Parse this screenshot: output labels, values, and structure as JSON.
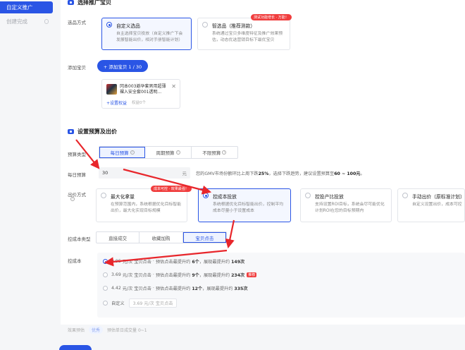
{
  "sidebar": {
    "items": [
      {
        "label": "自定义推广",
        "active": true
      },
      {
        "label": "创建完成",
        "active": false
      }
    ]
  },
  "section_promo": {
    "title": "选择推广宝贝",
    "method_label": "选品方式",
    "cards": [
      {
        "title": "自定义选品",
        "desc": "自主选择宝贝投放（自定义推广下会发展智能出价，相对手册智能计划）",
        "selected": true
      },
      {
        "title": "智选品（推荐测款）",
        "desc": "系统通过宝贝多维度特征及推广效果预估，动态优选营销目标下最优宝贝",
        "selected": false,
        "badge": "测试功能增长 · 万能！"
      }
    ],
    "add_label": "添加宝贝",
    "add_button": "+ 添加宝贝 1 / 30",
    "product": {
      "name": "冈本003避孕套男用超薄裸入安全套001透明...",
      "link": "+设置权益",
      "tip": "权益0个"
    }
  },
  "section_budget": {
    "title": "设置预算及出价",
    "budget_type_label": "预算类型",
    "budget_types": [
      "每日预算",
      "周期预算",
      "不限预算"
    ],
    "budget_label": "每日预算",
    "budget_value": "30",
    "budget_unit": "元",
    "budget_hint_pre": "您的GMV市场份额环比上周下跌",
    "budget_hint_pct": "25%",
    "budget_hint_mid": "，选择下跌趋势，建议设置预算至",
    "budget_hint_range": "60 ~ 100元",
    "budget_hint_end": "。",
    "bid_label": "出价方式",
    "bid_cards": [
      {
        "title": "最大化拿量",
        "desc": "在预算范围内，系统根据优化目标智能出价，最大化实现目标规模",
        "selected": false
      },
      {
        "title": "控成本投放",
        "desc": "系统根据优化目标智能出价，控制平均成本尽量小于设置成本",
        "selected": true,
        "badge": "成本可控 · 效果最强！"
      },
      {
        "title": "控投产比投放",
        "desc": "支持设置ROI目标，系统会尽可能优化计划ROI在您的目标预期内",
        "selected": false
      },
      {
        "title": "手动出价（原标准计划）",
        "desc": "自定义设置出价，成本可控",
        "selected": false
      }
    ],
    "cost_type_label": "控成本类型",
    "cost_types": [
      "直接成交",
      "收藏加购",
      "宝贝点击"
    ],
    "target_cost_label": "控成本",
    "cost_options": [
      {
        "value": "2.95",
        "unit": "元/次 宝贝点击",
        "desc_pre": "预估点击最提升约",
        "clicks": "6个",
        "desc_mid": "展现最提升约",
        "shows": "149次",
        "selected": true,
        "tag": ""
      },
      {
        "value": "3.69",
        "unit": "元/次 宝贝点击",
        "desc_pre": "预估点击最提升约",
        "clicks": "9个",
        "desc_mid": "展现最提升约",
        "shows": "234次",
        "selected": false,
        "tag": "推荐"
      },
      {
        "value": "4.42",
        "unit": "元/次 宝贝点击",
        "desc_pre": "预估点击最提升约",
        "clicks": "12个",
        "desc_mid": "展现最提升约",
        "shows": "335次",
        "selected": false,
        "tag": ""
      }
    ],
    "custom_label": "自定义",
    "custom_placeholder": "3.69 元/次 宝贝点击"
  },
  "effect": {
    "label": "效果预估",
    "pill": "优秀",
    "text": "预估单日成交量 0~1"
  },
  "colors": {
    "accent": "#2a55e5",
    "danger": "#f03d3d",
    "annotation_arrow": "#e8262b"
  }
}
